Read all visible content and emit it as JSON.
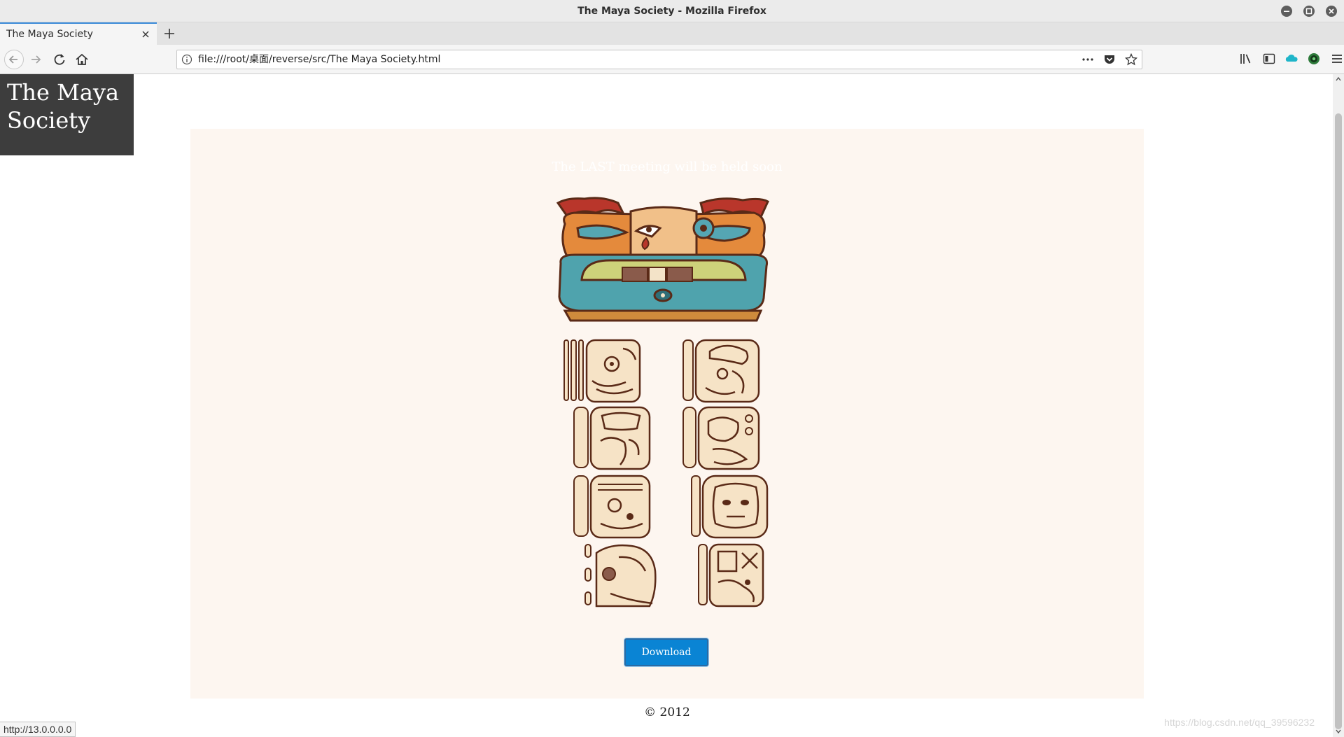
{
  "window": {
    "title": "The Maya Society - Mozilla Firefox"
  },
  "tabs": [
    {
      "label": "The Maya Society",
      "active": true
    }
  ],
  "navbar": {
    "url": "file:///root/桌面/reverse/src/The Maya Society.html"
  },
  "page": {
    "site_title": "The Maya Society",
    "announcement": "The LAST meeting will be held soon",
    "download_label": "Download",
    "footer": "© 2012",
    "watermark": "https://blog.csdn.net/qq_39596232"
  },
  "statusbar": {
    "link_preview": "http://13.0.0.0.0"
  },
  "icons": {
    "back": "arrow-left-icon",
    "forward": "arrow-right-icon",
    "reload": "reload-icon",
    "home": "home-icon",
    "info": "info-icon",
    "page_actions": "ellipsis-icon",
    "pocket": "pocket-icon",
    "bookmark": "star-icon",
    "library": "library-icon",
    "sidebar": "sidebar-icon",
    "ext_cloud": "cloud-extension-icon",
    "ext_shield": "shield-extension-icon",
    "menu": "hamburger-menu-icon"
  },
  "colors": {
    "panel_bg": "#fdf6f0",
    "title_box_bg": "#3d3d3d",
    "download_button": "#0a84d4",
    "tab_accent": "#3b8bd9"
  }
}
